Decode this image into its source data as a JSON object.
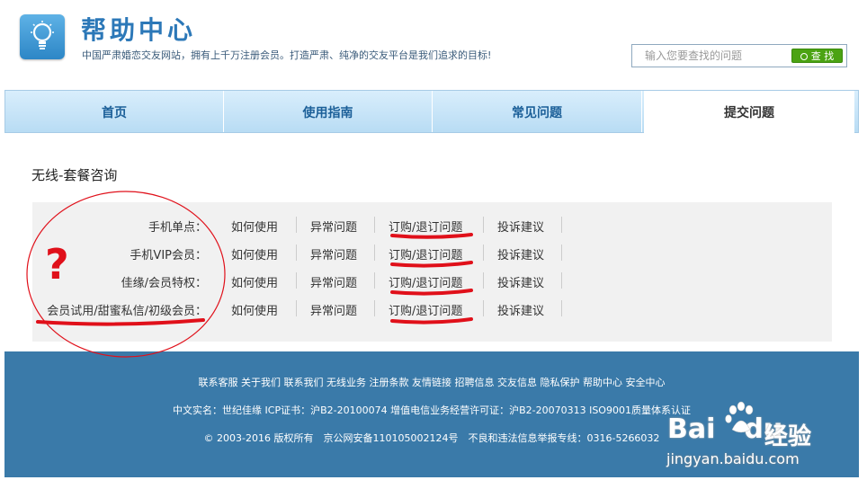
{
  "header": {
    "title": "帮助中心",
    "slogan": "中国严肃婚恋交友网站，拥有上千万注册会员。打造严肃、纯净的交友平台是我们追求的目标!",
    "search_placeholder": "输入您要查找的问题",
    "search_button": "查 找"
  },
  "nav": {
    "tabs": [
      {
        "label": "首页"
      },
      {
        "label": "使用指南"
      },
      {
        "label": "常见问题"
      },
      {
        "label": "提交问题",
        "active": true
      }
    ]
  },
  "content": {
    "section_title": "无线-套餐咨询",
    "rows": [
      {
        "label": "手机单点：",
        "links": [
          "如何使用",
          "异常问题",
          "订购/退订问题",
          "投诉建议"
        ]
      },
      {
        "label": "手机VIP会员：",
        "links": [
          "如何使用",
          "异常问题",
          "订购/退订问题",
          "投诉建议"
        ]
      },
      {
        "label": "佳缘/会员特权：",
        "links": [
          "如何使用",
          "异常问题",
          "订购/退订问题",
          "投诉建议"
        ]
      },
      {
        "label": "会员试用/甜蜜私信/初级会员：",
        "links": [
          "如何使用",
          "异常问题",
          "订购/退订问题",
          "投诉建议"
        ]
      }
    ]
  },
  "footer": {
    "links_line": "联系客服 关于我们 联系我们 无线业务 注册条款 友情链接 招聘信息 交友信息 隐私保护 帮助中心 安全中心",
    "license_line": "中文实名：世纪佳缘 ICP证书：沪B2-20100074 增值电信业务经营许可证：沪B2-20070313 ISO9001质量体系认证",
    "copyright_line": "© 2003-2016 版权所有　京公网安备110105002124号　不良和违法信息举报专线：0316-5266032"
  },
  "annotation": {
    "question_mark": "?"
  },
  "watermark": {
    "brand": "Bai",
    "brand2": "du",
    "brand_cn": "经验",
    "url": "jingyan.baidu.com"
  },
  "colors": {
    "title_blue": "#2c78b8",
    "nav_text": "#1b5f98",
    "search_green": "#4ba313",
    "footer_blue": "#3a7aa9",
    "annotation_red": "#e0101a"
  }
}
